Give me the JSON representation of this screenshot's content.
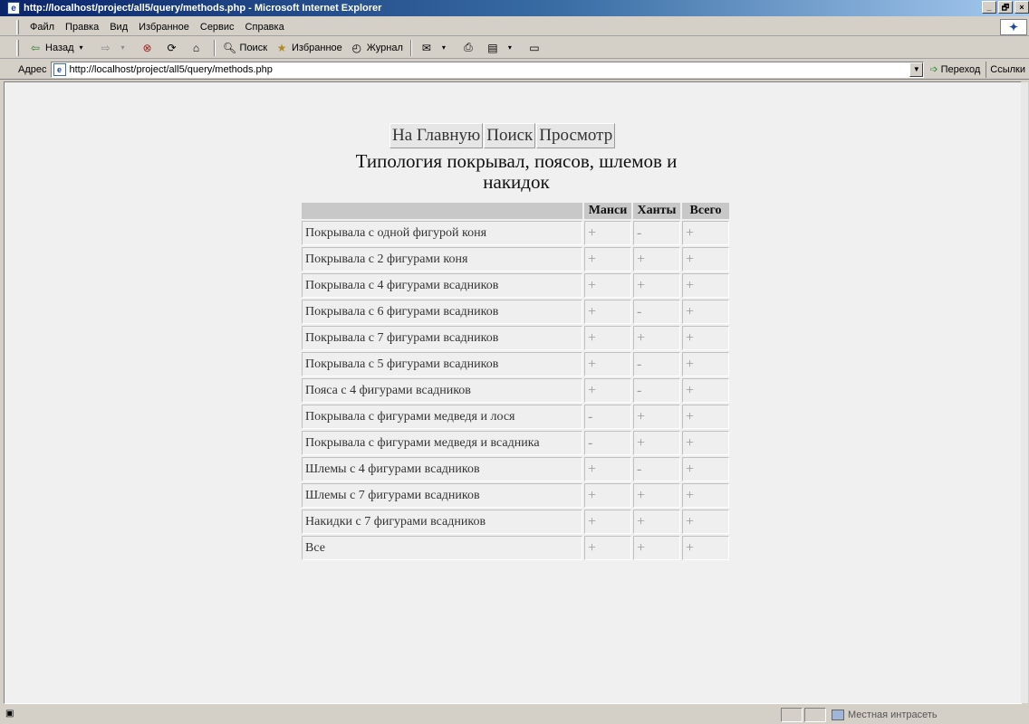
{
  "window": {
    "title": "http://localhost/project/all5/query/methods.php - Microsoft Internet Explorer",
    "controls": [
      "_",
      "🗗",
      "×"
    ]
  },
  "menu": {
    "items": [
      "Файл",
      "Правка",
      "Вид",
      "Избранное",
      "Сервис",
      "Справка"
    ]
  },
  "toolbar": {
    "back_label": "Назад",
    "search_label": "Поиск",
    "favorites_label": "Избранное",
    "history_label": "Журнал"
  },
  "address": {
    "label": "Адрес",
    "url": "http://localhost/project/all5/query/methods.php",
    "go_label": "Переход",
    "links_label": "Ссылки"
  },
  "page": {
    "nav": {
      "home": "На Главную",
      "search": "Поиск",
      "view": "Просмотр"
    },
    "heading_line1": "Типология покрывал, поясов, шлемов и",
    "heading_line2": "накидок",
    "table": {
      "columns": [
        "",
        "Манси",
        "Ханты",
        "Всего"
      ],
      "rows": [
        {
          "name": "Покрывала с одной фигурой коня",
          "mansi": "+",
          "khanty": "-",
          "total": "+"
        },
        {
          "name": "Покрывала с 2 фигурами коня",
          "mansi": "+",
          "khanty": "+",
          "total": "+"
        },
        {
          "name": "Покрывала с 4 фигурами всадников",
          "mansi": "+",
          "khanty": "+",
          "total": "+"
        },
        {
          "name": "Покрывала с 6 фигурами всадников",
          "mansi": "+",
          "khanty": "-",
          "total": "+"
        },
        {
          "name": "Покрывала с 7 фигурами всадников",
          "mansi": "+",
          "khanty": "+",
          "total": "+"
        },
        {
          "name": "Покрывала с 5 фигурами всадников",
          "mansi": "+",
          "khanty": "-",
          "total": "+"
        },
        {
          "name": "Пояса с 4 фигурами всадников",
          "mansi": "+",
          "khanty": "-",
          "total": "+"
        },
        {
          "name": "Покрывала с фигурами медведя и лося",
          "mansi": "-",
          "khanty": "+",
          "total": "+"
        },
        {
          "name": "Покрывала с фигурами медведя и всадника",
          "mansi": "-",
          "khanty": "+",
          "total": "+"
        },
        {
          "name": "Шлемы с 4 фигурами всадников",
          "mansi": "+",
          "khanty": "-",
          "total": "+"
        },
        {
          "name": "Шлемы с 7 фигурами всадников",
          "mansi": "+",
          "khanty": "+",
          "total": "+"
        },
        {
          "name": "Накидки с 7 фигурами всадников",
          "mansi": "+",
          "khanty": "+",
          "total": "+"
        },
        {
          "name": "Все",
          "mansi": "+",
          "khanty": "+",
          "total": "+"
        }
      ]
    }
  },
  "status": {
    "zone_label": "Местная интрасеть"
  }
}
